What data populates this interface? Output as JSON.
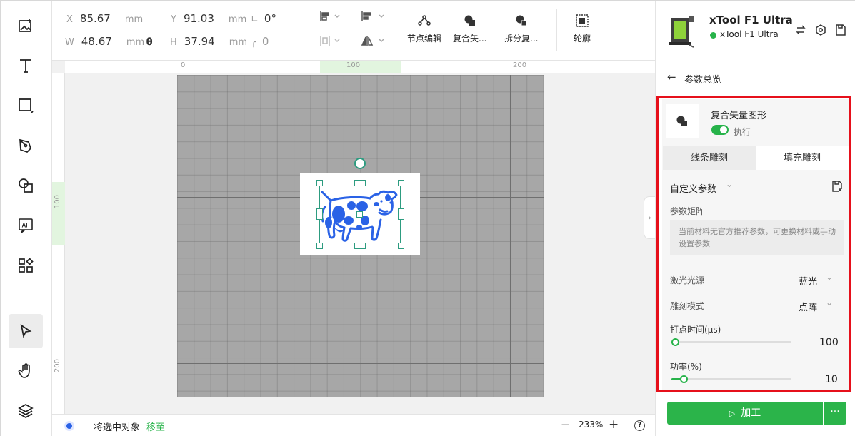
{
  "topbar": {
    "x_key": "X",
    "x_value": "85.67",
    "x_unit": "mm",
    "y_key": "Y",
    "y_value": "91.03",
    "y_unit": "mm",
    "angle_value": "0°",
    "w_key": "W",
    "w_value": "48.67",
    "w_unit": "mm",
    "h_key": "H",
    "h_value": "37.94",
    "h_unit": "mm",
    "corner_value": "0",
    "tools": [
      {
        "label": "节点编辑",
        "icon": "node-edit-icon"
      },
      {
        "label": "复合矢...",
        "icon": "combine-icon"
      },
      {
        "label": "拆分复...",
        "icon": "split-icon"
      },
      {
        "label": "轮廓",
        "icon": "outline-icon"
      }
    ]
  },
  "canvas": {
    "ruler_h_ticks": [
      "0",
      "100",
      "200"
    ],
    "ruler_v_ticks": [
      "100",
      "200"
    ]
  },
  "bottom": {
    "status_text": "将选中对象",
    "status_link": "移至",
    "zoom": "233%",
    "zoom_minus": "—",
    "zoom_plus": "+",
    "help": "?"
  },
  "device": {
    "name": "xTool F1 Ultra",
    "model": "xTool F1 Ultra",
    "status_color": "#27b34a"
  },
  "panel": {
    "back_title": "参数总览",
    "object_name": "复合矢量图形",
    "execute_label": "执行",
    "tabs": [
      "线条雕刻",
      "填充雕刻"
    ],
    "active_tab": 1,
    "preset_label": "自定义参数",
    "matrix_label": "参数矩阵",
    "notice": "当前材料无官方推荐参数，可更换材料或手动设置参数",
    "laser_label": "激光光源",
    "laser_value": "蓝光",
    "mode_label": "雕刻模式",
    "mode_value": "点阵",
    "dot_time_label": "打点时间(μs)",
    "dot_time_value": "100",
    "dot_time_fraction": 0.02,
    "power_label": "功率(%)",
    "power_value": "10",
    "power_fraction": 0.1,
    "run_label": "加工",
    "more_label": "···"
  },
  "colors": {
    "accent": "#27b34a",
    "highlight": "#e6101b",
    "cow": "#2a62e6"
  }
}
